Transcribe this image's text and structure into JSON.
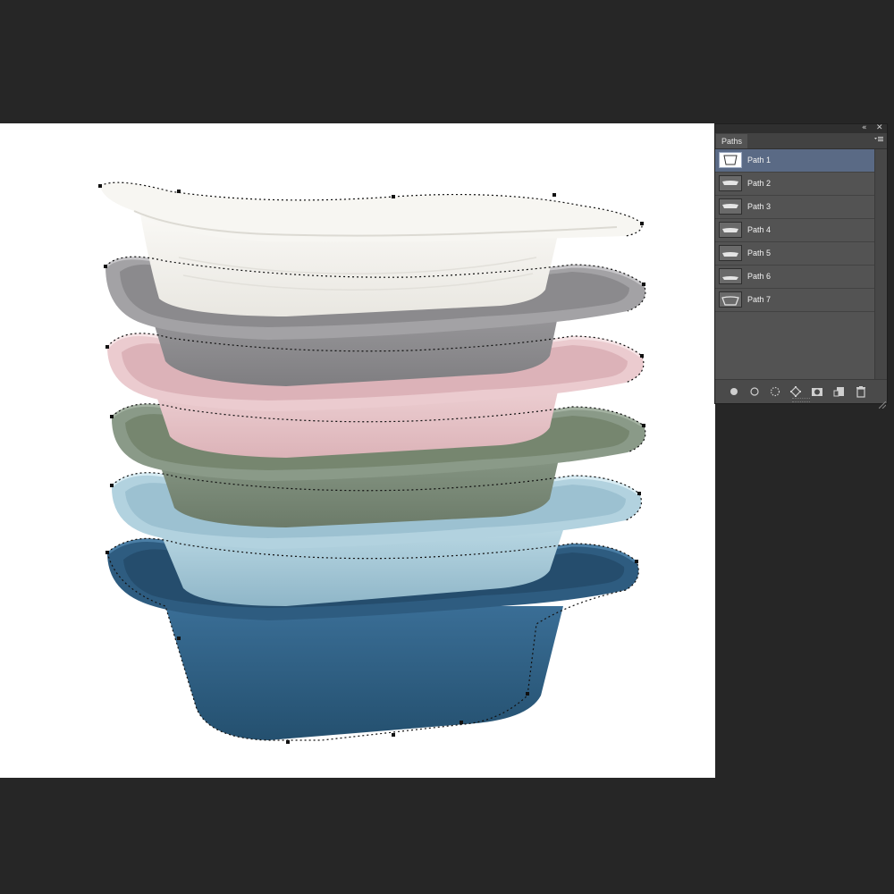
{
  "panel": {
    "collapse_icon": "double-chevron-left-icon",
    "close_label": "✕",
    "tab_label": "Paths",
    "menu_icon": "panel-menu-icon",
    "paths": [
      {
        "name": "Path 1",
        "selected": true
      },
      {
        "name": "Path 2",
        "selected": false
      },
      {
        "name": "Path 3",
        "selected": false
      },
      {
        "name": "Path 4",
        "selected": false
      },
      {
        "name": "Path 5",
        "selected": false
      },
      {
        "name": "Path 6",
        "selected": false
      },
      {
        "name": "Path 7",
        "selected": false
      }
    ],
    "footer_icons": [
      "fill-path-icon",
      "stroke-path-icon",
      "load-path-as-selection-icon",
      "make-work-path-icon",
      "add-mask-icon",
      "new-path-icon",
      "delete-path-icon"
    ]
  },
  "canvas": {
    "subject": "stack of colored baby bathtubs",
    "tub_colors": [
      "#f1f0ec",
      "#8d8c8f",
      "#e6c4c8",
      "#7b8a78",
      "#a9c9d6",
      "#2f5f84"
    ]
  }
}
